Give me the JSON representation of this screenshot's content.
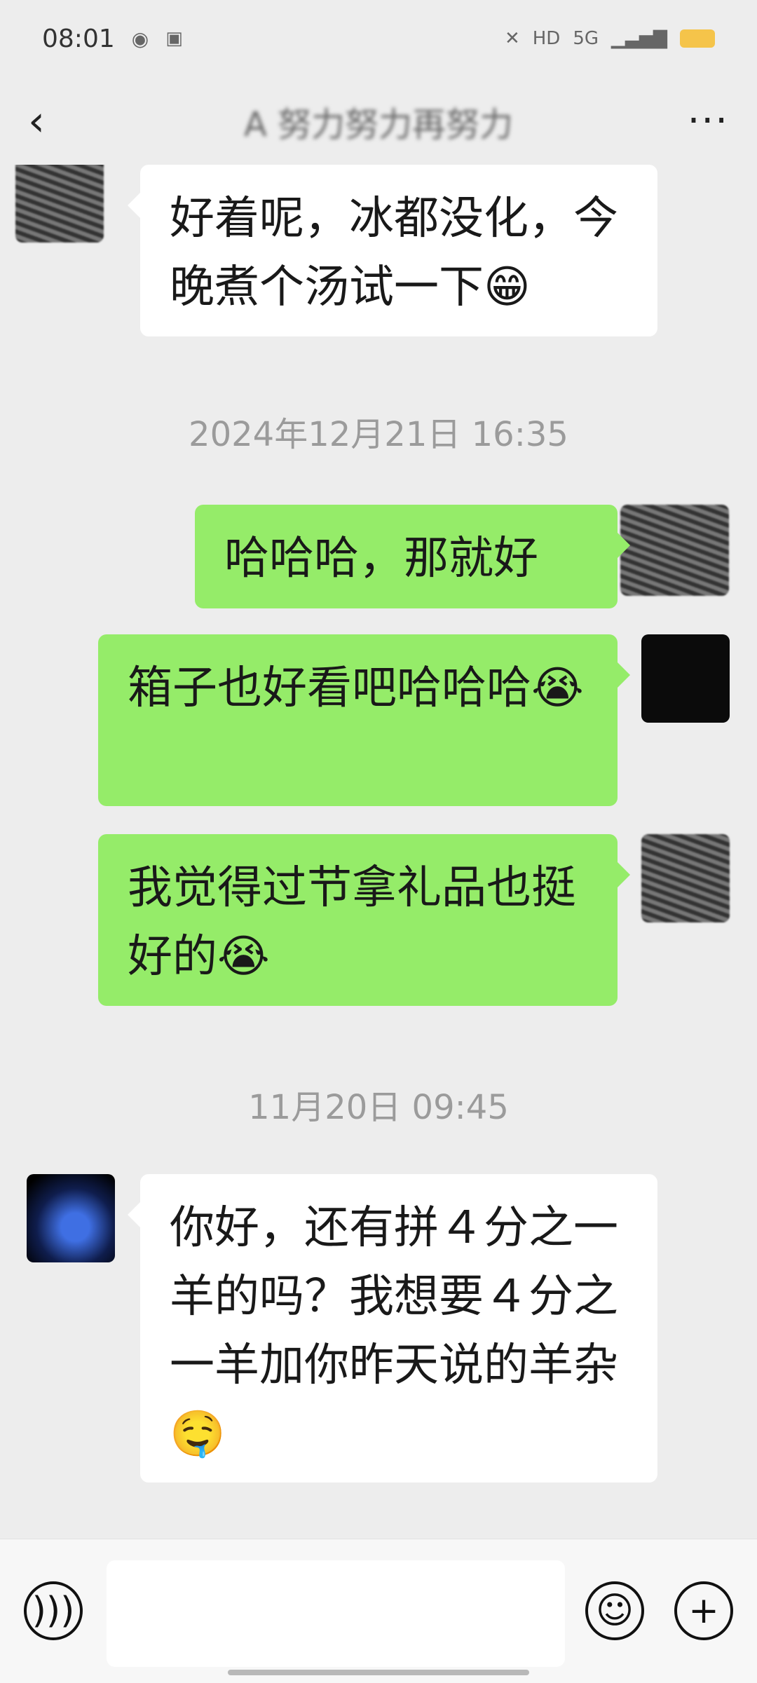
{
  "status_bar": {
    "time": "08:01",
    "network": "5G",
    "icons": [
      "notification-icon",
      "nfc-icon",
      "mute-icon",
      "hd-icon",
      "signal-icon",
      "battery-icon"
    ]
  },
  "header": {
    "back_icon": "chevron-left-icon",
    "title": "A 努力努力再努力",
    "more_icon": "more-dots-icon"
  },
  "messages": [
    {
      "side": "left",
      "text": "好着呢，冰都没化，今晚煮个汤试一下😁"
    },
    {
      "type": "timestamp",
      "text": "2024年12月21日 16:35"
    },
    {
      "side": "right",
      "text": "哈哈哈，那就好"
    },
    {
      "side": "right",
      "text": "箱子也好看吧哈哈哈😭"
    },
    {
      "side": "right",
      "text": "我觉得过节拿礼品也挺好的😭"
    },
    {
      "type": "timestamp",
      "text": "11月20日 09:45"
    },
    {
      "side": "left",
      "text": "你好，还有拼４分之一羊的吗？我想要４分之一羊加你昨天说的羊杂🤤"
    }
  ],
  "input_bar": {
    "voice_icon": "voice-icon",
    "input_placeholder": "",
    "emoji_icon": "emoji-icon",
    "plus_icon": "plus-icon"
  },
  "colors": {
    "background": "#ededed",
    "bubble_self": "#95ec69",
    "bubble_other": "#ffffff",
    "timestamp": "#9b9b9b"
  }
}
